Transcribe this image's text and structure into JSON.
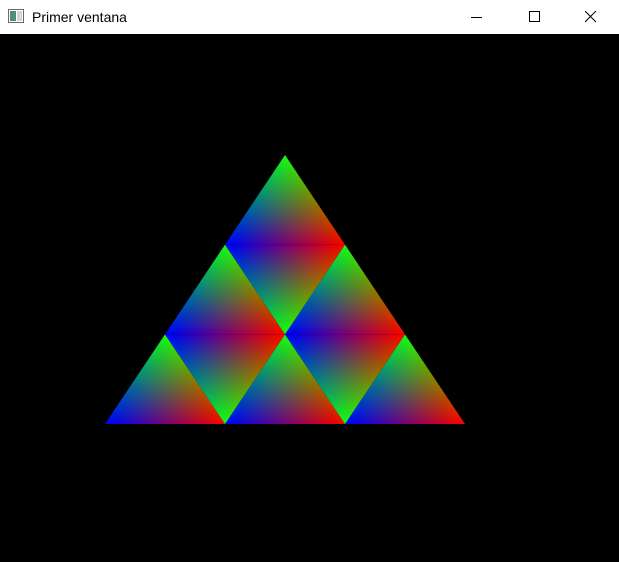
{
  "window": {
    "title": "Primer ventana",
    "icon": "app-window-icon",
    "controls": [
      "minimize-icon",
      "maximize-icon",
      "close-icon"
    ]
  },
  "scene": {
    "background": "#000000",
    "vertex_colors": {
      "red": "#ff0000",
      "green": "#00ff00",
      "blue": "#0000ff"
    }
  }
}
